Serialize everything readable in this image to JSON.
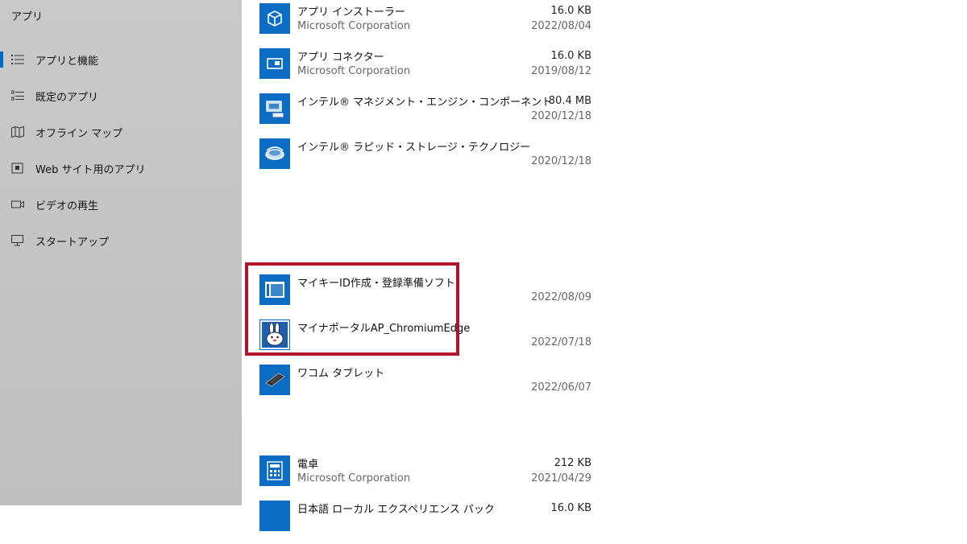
{
  "sidebar": {
    "title": "アプリ",
    "items": [
      {
        "label": "アプリと機能",
        "icon": "apps-list-icon",
        "selected": true
      },
      {
        "label": "既定のアプリ",
        "icon": "default-apps-icon",
        "selected": false
      },
      {
        "label": "オフライン マップ",
        "icon": "offline-map-icon",
        "selected": false
      },
      {
        "label": "Web サイト用のアプリ",
        "icon": "web-apps-icon",
        "selected": false
      },
      {
        "label": "ビデオの再生",
        "icon": "video-icon",
        "selected": false
      },
      {
        "label": "スタートアップ",
        "icon": "startup-icon",
        "selected": false
      }
    ]
  },
  "apps": [
    {
      "name": "アプリ インストーラー",
      "publisher": "Microsoft Corporation",
      "size": "16.0 KB",
      "date": "2022/08/04",
      "icon": "box-icon"
    },
    {
      "name": "アプリ コネクター",
      "publisher": "Microsoft Corporation",
      "size": "16.0 KB",
      "date": "2019/08/12",
      "icon": "connector-icon"
    },
    {
      "name": "インテル® マネジメント・エンジン・コンポーネント",
      "publisher": "",
      "size": "80.4 MB",
      "date": "2020/12/18",
      "icon": "intel-me-icon"
    },
    {
      "name": "インテル® ラピッド・ストレージ・テクノロジー",
      "publisher": "",
      "size": "",
      "date": "2020/12/18",
      "icon": "intel-rst-icon"
    },
    {
      "name": "マイキーID作成・登録準備ソフト",
      "publisher": "",
      "size": "",
      "date": "2022/08/09",
      "icon": "window-app-icon"
    },
    {
      "name": "マイナポータルAP_ChromiumEdge",
      "publisher": "",
      "size": "",
      "date": "2022/07/18",
      "icon": "mynaportal-rabbit-icon"
    },
    {
      "name": "ワコム タブレット",
      "publisher": "",
      "size": "",
      "date": "2022/06/07",
      "icon": "tablet-icon"
    },
    {
      "name": "電卓",
      "publisher": "Microsoft Corporation",
      "size": "212 KB",
      "date": "2021/04/29",
      "icon": "calculator-icon"
    },
    {
      "name": "日本語 ローカル エクスペリエンス パック",
      "publisher": "",
      "size": "16.0 KB",
      "date": "",
      "icon": "language-pack-icon"
    }
  ],
  "colors": {
    "accent": "#0067c0",
    "app_tile": "#0b6cc4",
    "highlight_border": "#b0152b"
  }
}
